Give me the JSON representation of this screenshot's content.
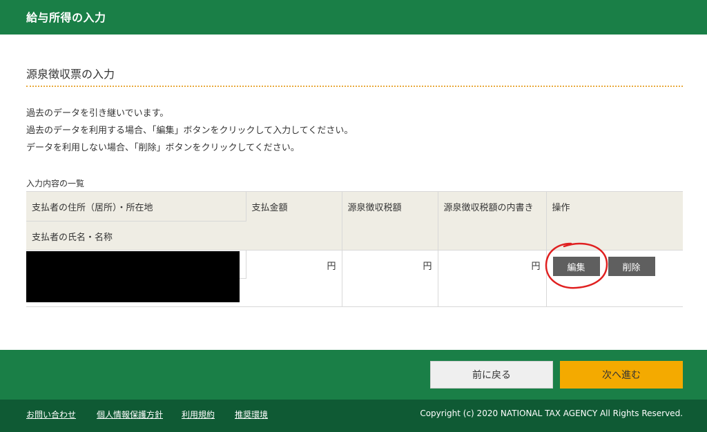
{
  "header": {
    "title": "給与所得の入力"
  },
  "section": {
    "title": "源泉徴収票の入力"
  },
  "description": [
    "過去のデータを引き継いでいます。",
    "過去のデータを利用する場合、「編集」ボタンをクリックして入力してください。",
    "データを利用しない場合、「削除」ボタンをクリックしてください。"
  ],
  "list": {
    "label": "入力内容の一覧",
    "headers": {
      "payer_address": "支払者の住所（居所）・所在地",
      "payer_name": "支払者の氏名・名称",
      "payment_amount": "支払金額",
      "withholding_tax": "源泉徴収税額",
      "withholding_breakdown": "源泉徴収税額の内書き",
      "operation": "操作"
    },
    "rows": [
      {
        "payment_amount_unit": "円",
        "withholding_tax_unit": "円",
        "withholding_breakdown_unit": "円",
        "edit_label": "編集",
        "delete_label": "削除"
      }
    ]
  },
  "actions": {
    "back_label": "前に戻る",
    "next_label": "次へ進む"
  },
  "footer": {
    "links": [
      "お問い合わせ",
      "個人情報保護方針",
      "利用規約",
      "推奨環境"
    ],
    "copyright": "Copyright (c) 2020 NATIONAL TAX AGENCY All Rights Reserved."
  },
  "colors": {
    "header_bg": "#1a7f47",
    "footer_bg": "#0f5a34",
    "next_button": "#f4aa00",
    "dark_button": "#5f5f5f"
  }
}
